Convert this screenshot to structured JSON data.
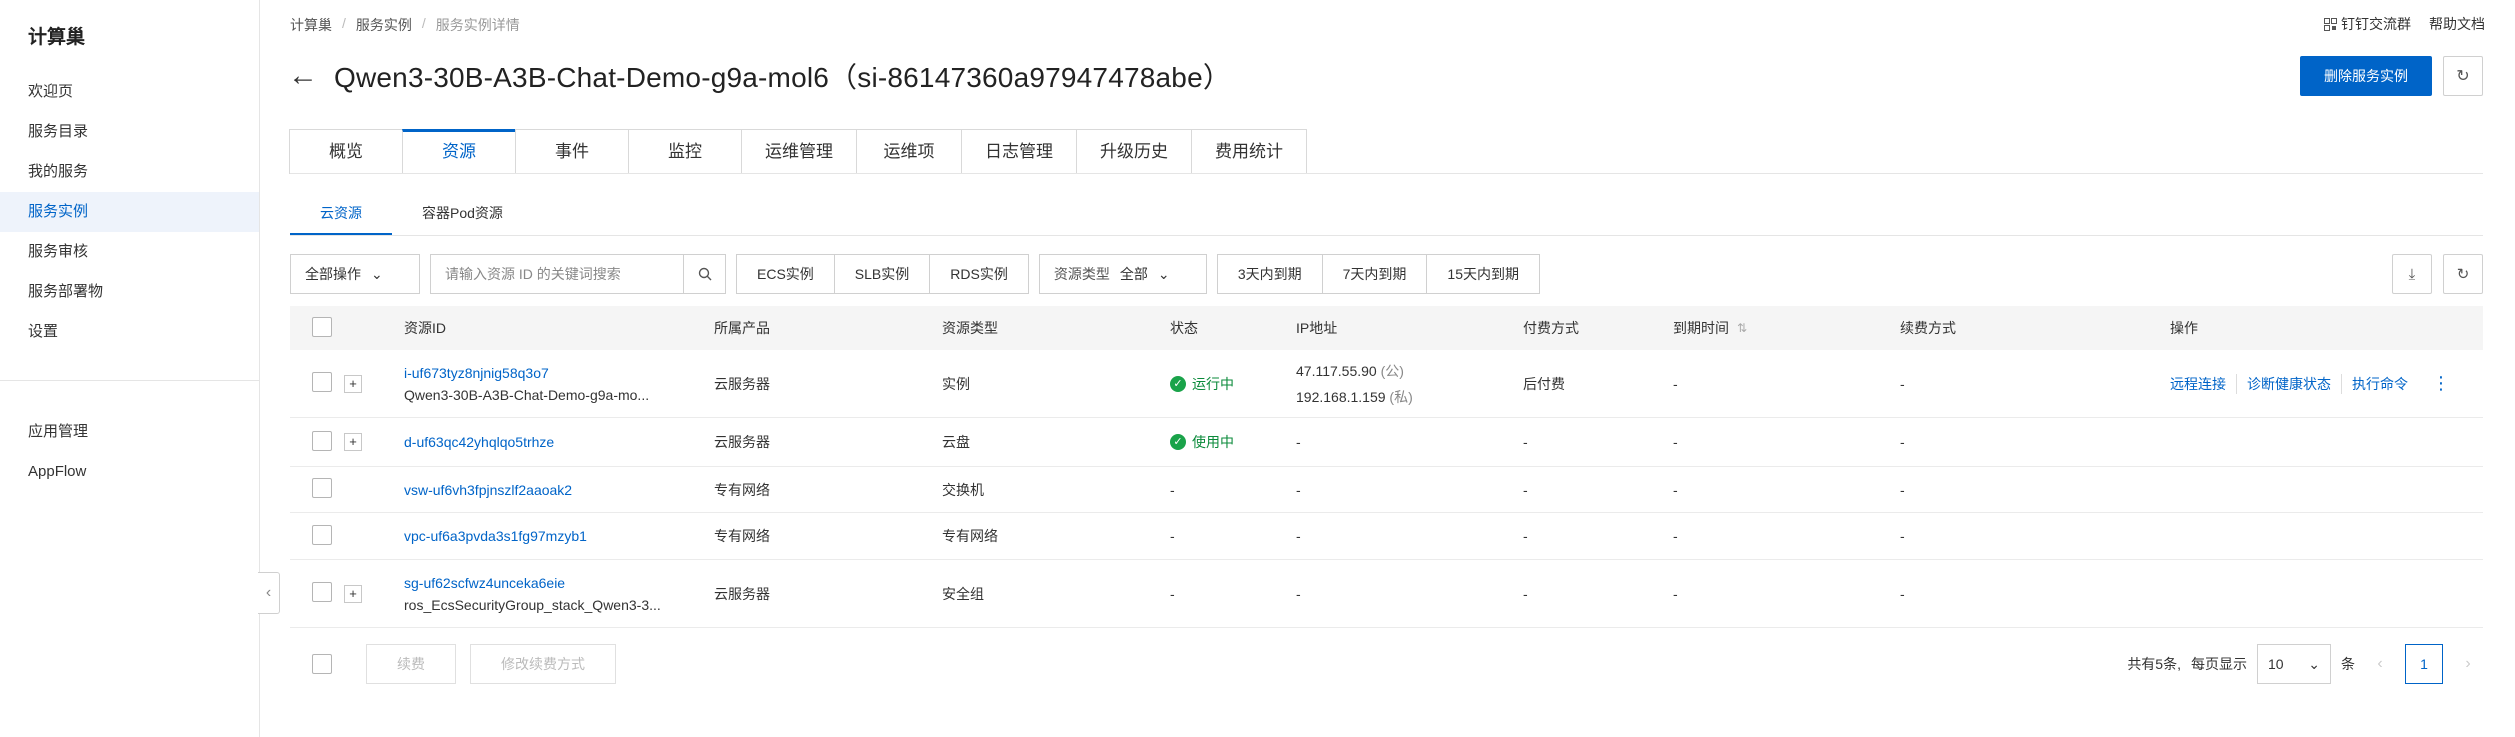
{
  "sidebar": {
    "brand": "计算巢",
    "items": [
      {
        "label": "欢迎页"
      },
      {
        "label": "服务目录"
      },
      {
        "label": "我的服务"
      },
      {
        "label": "服务实例"
      },
      {
        "label": "服务审核"
      },
      {
        "label": "服务部署物"
      },
      {
        "label": "设置"
      }
    ],
    "items2": [
      {
        "label": "应用管理"
      },
      {
        "label": "AppFlow"
      }
    ]
  },
  "top_links": {
    "dingtalk": "钉钉交流群",
    "help": "帮助文档"
  },
  "breadcrumb": [
    "计算巢",
    "服务实例",
    "服务实例详情"
  ],
  "header": {
    "title": "Qwen3-30B-A3B-Chat-Demo-g9a-mol6（si-86147360a97947478abe）",
    "delete_label": "删除服务实例"
  },
  "main_tabs": [
    "概览",
    "资源",
    "事件",
    "监控",
    "运维管理",
    "运维项",
    "日志管理",
    "升级历史",
    "费用统计"
  ],
  "sub_tabs": [
    "云资源",
    "容器Pod资源"
  ],
  "toolbar": {
    "all_ops": "全部操作",
    "search_placeholder": "请输入资源 ID 的关键词搜索",
    "filters": [
      "ECS实例",
      "SLB实例",
      "RDS实例"
    ],
    "type_label": "资源类型",
    "type_value": "全部",
    "expiry": [
      "3天内到期",
      "7天内到期",
      "15天内到期"
    ]
  },
  "table": {
    "headers": {
      "id": "资源ID",
      "product": "所属产品",
      "type": "资源类型",
      "status": "状态",
      "ip": "IP地址",
      "pay": "付费方式",
      "expire": "到期时间",
      "renew": "续费方式",
      "ops": "操作"
    },
    "rows": [
      {
        "id": "i-uf673tyz8njnig58q3o7",
        "sub": "Qwen3-30B-A3B-Chat-Demo-g9a-mo...",
        "product": "云服务器",
        "type": "实例",
        "status": "运行中",
        "ip1": "47.117.55.90",
        "ip1_tag": "(公)",
        "ip2": "192.168.1.159",
        "ip2_tag": "(私)",
        "pay": "后付费",
        "expire": "-",
        "renew": "-",
        "ops": [
          "远程连接",
          "诊断健康状态",
          "执行命令"
        ]
      },
      {
        "id": "d-uf63qc42yhqlqo5trhze",
        "product": "云服务器",
        "type": "云盘",
        "status": "使用中",
        "ip": "-",
        "pay": "-",
        "expire": "-",
        "renew": "-"
      },
      {
        "id": "vsw-uf6vh3fpjnszlf2aaoak2",
        "product": "专有网络",
        "type": "交换机",
        "status": "-",
        "ip": "-",
        "pay": "-",
        "expire": "-",
        "renew": "-"
      },
      {
        "id": "vpc-uf6a3pvda3s1fg97mzyb1",
        "product": "专有网络",
        "type": "专有网络",
        "status": "-",
        "ip": "-",
        "pay": "-",
        "expire": "-",
        "renew": "-"
      },
      {
        "id": "sg-uf62scfwz4unceka6eie",
        "sub": "ros_EcsSecurityGroup_stack_Qwen3-3...",
        "product": "云服务器",
        "type": "安全组",
        "status": "-",
        "ip": "-",
        "pay": "-",
        "expire": "-",
        "renew": "-"
      }
    ]
  },
  "footer": {
    "renew": "续费",
    "modify_renew": "修改续费方式",
    "total": "共有5条,",
    "per_page": "每页显示",
    "page_size": "10",
    "unit": "条",
    "current_page": "1"
  },
  "colors": {
    "accent": "#0064c8",
    "success": "#1aa34a"
  }
}
